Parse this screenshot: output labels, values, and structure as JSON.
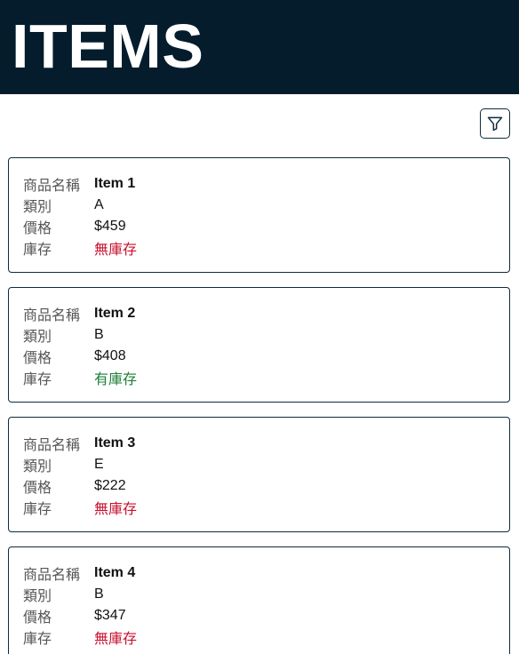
{
  "header": {
    "title": "ITEMS"
  },
  "toolbar": {
    "filter_icon": "filter-icon"
  },
  "labels": {
    "name": "商品名稱",
    "category": "類別",
    "price": "價格",
    "stock": "庫存"
  },
  "items": [
    {
      "name": "Item 1",
      "category": "A",
      "price": "$459",
      "stock": "無庫存",
      "in_stock": false
    },
    {
      "name": "Item 2",
      "category": "B",
      "price": "$408",
      "stock": "有庫存",
      "in_stock": true
    },
    {
      "name": "Item 3",
      "category": "E",
      "price": "$222",
      "stock": "無庫存",
      "in_stock": false
    },
    {
      "name": "Item 4",
      "category": "B",
      "price": "$347",
      "stock": "無庫存",
      "in_stock": false
    }
  ],
  "colors": {
    "header_bg": "#041c2c",
    "out_of_stock": "#c8102e",
    "in_stock": "#1a7f37"
  }
}
